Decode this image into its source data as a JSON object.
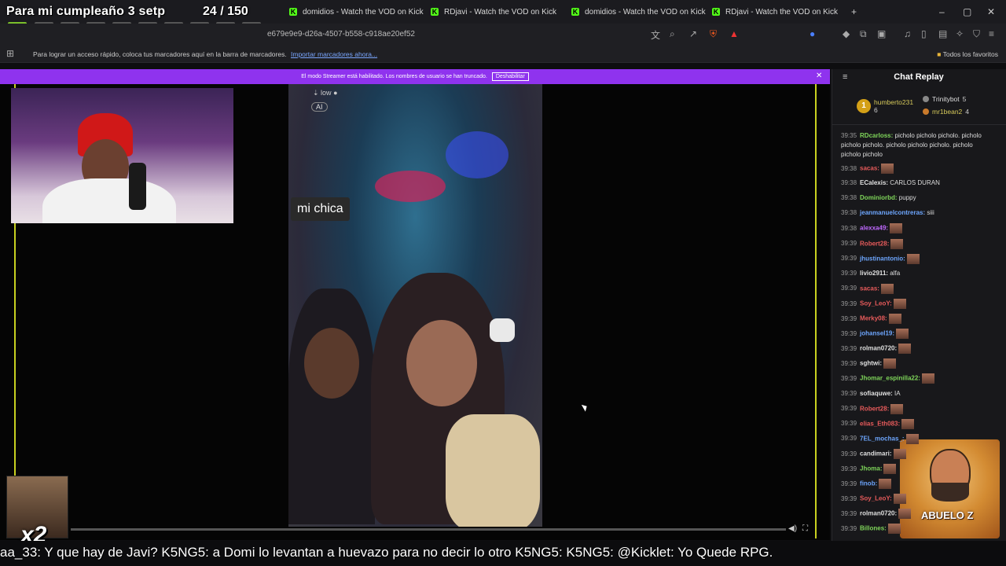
{
  "overlay": {
    "title": "Para mi cumpleaño 3 setp",
    "count": "24 / 150"
  },
  "tabs": [
    {
      "label": "domidios - Watch the VOD on Kick"
    },
    {
      "label": "RDjavi - Watch the VOD on Kick"
    },
    {
      "label": "domidios - Watch the VOD on Kick"
    },
    {
      "label": "RDjavi - Watch the VOD on Kick"
    }
  ],
  "address": {
    "url": "e679e9e9-d26a-4507-b558-c918ae20ef52"
  },
  "bookmarks": {
    "text": "Para lograr un acceso rápido, coloca tus marcadores aquí en la barra de marcadores.",
    "import_link": "Importar marcadores ahora...",
    "all_label": "Todos los favoritos"
  },
  "banner": {
    "text": "El modo Streamer está habilitado. Los nombres de usuario se han truncado.",
    "button": "Deshabilitar"
  },
  "player": {
    "caption": "mi chica",
    "quality": "low",
    "ai_label": "AI"
  },
  "emote_overlay": {
    "multiplier": "x2"
  },
  "chat": {
    "title": "Chat Replay",
    "leaderboard": [
      {
        "rank": "1",
        "name": "humberto231",
        "count": "6"
      },
      {
        "name": "Trinitybot",
        "count": "5"
      },
      {
        "name": "mr1bean2",
        "count": "4"
      }
    ],
    "messages": [
      {
        "time": "39:35",
        "user": "RDcarloss",
        "color": "#7fd65a",
        "text": "picholo picholo picholo. picholo picholo picholo. picholo picholo picholo. picholo picholo picholo"
      },
      {
        "time": "39:38",
        "user": "sacas",
        "color": "#e85b5b",
        "text": ""
      },
      {
        "time": "39:38",
        "user": "ECalexis",
        "color": "#e0e0e0",
        "text": "CARLOS DURAN"
      },
      {
        "time": "39:38",
        "user": "Dominiorbd",
        "color": "#7fd65a",
        "text": "puppy"
      },
      {
        "time": "39:38",
        "user": "jeanmanuelcontreras",
        "color": "#6ea7ff",
        "text": "siii"
      },
      {
        "time": "39:38",
        "user": "alexxa49",
        "color": "#c069ff",
        "text": ""
      },
      {
        "time": "39:39",
        "user": "Robert28",
        "color": "#e85b5b",
        "text": ""
      },
      {
        "time": "39:39",
        "user": "jhustinantonio",
        "color": "#6ea7ff",
        "text": ""
      },
      {
        "time": "39:39",
        "user": "livio2911",
        "color": "#e0e0e0",
        "text": "alfa"
      },
      {
        "time": "39:39",
        "user": "sacas",
        "color": "#e85b5b",
        "text": ""
      },
      {
        "time": "39:39",
        "user": "Soy_LeoY",
        "color": "#e85b5b",
        "text": ""
      },
      {
        "time": "39:39",
        "user": "Merky08",
        "color": "#e85b5b",
        "text": ""
      },
      {
        "time": "39:39",
        "user": "johansel19",
        "color": "#6ea7ff",
        "text": ""
      },
      {
        "time": "39:39",
        "user": "rolman0720",
        "color": "#e0e0e0",
        "text": ""
      },
      {
        "time": "39:39",
        "user": "sghtwi",
        "color": "#e0e0e0",
        "text": ""
      },
      {
        "time": "39:39",
        "user": "Jhomar_espinilla22",
        "color": "#7fd65a",
        "text": ""
      },
      {
        "time": "39:39",
        "user": "sofiaquwe",
        "color": "#e0e0e0",
        "text": "IA"
      },
      {
        "time": "39:39",
        "user": "Robert28",
        "color": "#e85b5b",
        "text": ""
      },
      {
        "time": "39:39",
        "user": "elias_Eth083",
        "color": "#e85b5b",
        "text": ""
      },
      {
        "time": "39:39",
        "user": "7EL_mochas_",
        "color": "#6ea7ff",
        "text": ""
      },
      {
        "time": "39:39",
        "user": "candimari",
        "color": "#e0e0e0",
        "text": ""
      },
      {
        "time": "39:39",
        "user": "Jhoma",
        "color": "#7fd65a",
        "text": ""
      },
      {
        "time": "39:39",
        "user": "finob",
        "color": "#6ea7ff",
        "text": ""
      },
      {
        "time": "39:39",
        "user": "Soy_LeoY",
        "color": "#e85b5b",
        "text": ""
      },
      {
        "time": "39:39",
        "user": "rolman0720",
        "color": "#e0e0e0",
        "text": ""
      },
      {
        "time": "39:39",
        "user": "Billones",
        "color": "#7fd65a",
        "text": ""
      }
    ]
  },
  "avatar": {
    "label": "ABUELO Z"
  },
  "ticker": {
    "text": "aa_33: Y que hay de Javi?  K5NG5: a Domi lo levantan a huevazo para no decir lo otro  K5NG5:   K5NG5:   @Kicklet: Yo Quede RPG."
  }
}
